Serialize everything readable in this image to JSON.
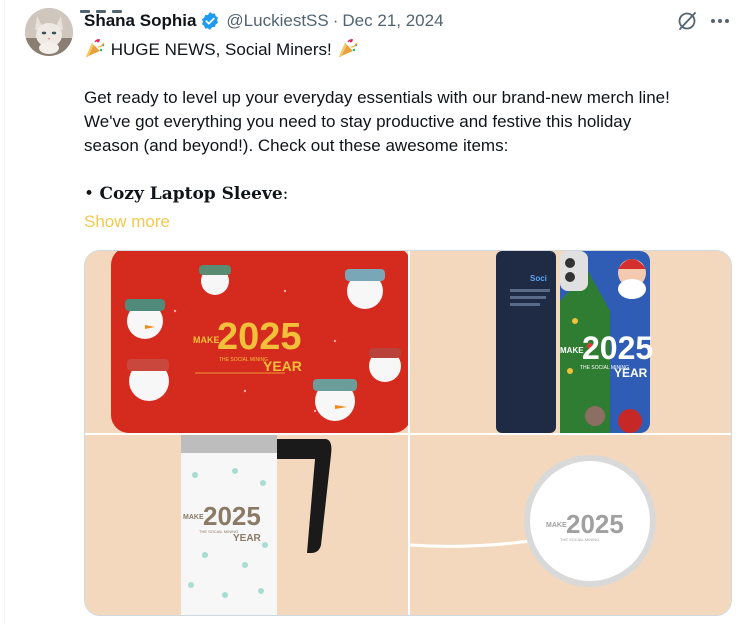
{
  "author": {
    "name": "Shana Sophia",
    "handle": "@LuckiestSS",
    "date": "Dec 21, 2024"
  },
  "tweet": {
    "headline": "HUGE NEWS, Social Miners!",
    "lines": [
      "Get ready to level up your everyday essentials with our brand-new merch line!",
      "We've got everything you need to stay productive and festive this holiday",
      "season (and beyond!). Check out these awesome items:"
    ],
    "bullet_symbol": "•",
    "bullet_item": "Cozy Laptop Sleeve",
    "bullet_suffix": ":",
    "show_more": "Show more"
  },
  "media": {
    "brand_top": "2025",
    "brand_make": "MAKE",
    "brand_mid": "THE SOCIAL MINING",
    "brand_year": "YEAR",
    "phone_label": "Soci"
  },
  "icons": {
    "verified": "verified-badge-icon",
    "grok": "grok-icon",
    "more": "more-icon",
    "party": "party-popper-icon"
  },
  "colors": {
    "verified_blue": "#1d9bf0",
    "show_more": "#f2c94c",
    "muted": "#536471",
    "media_bg": "#f5d9bd"
  }
}
